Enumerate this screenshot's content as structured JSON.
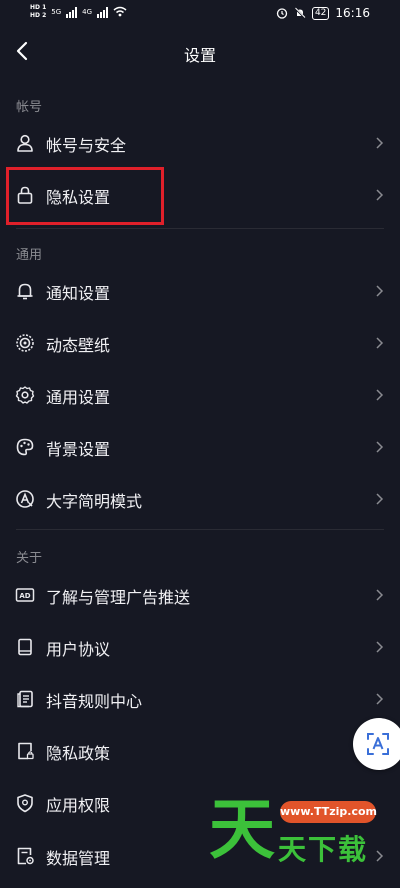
{
  "status_bar": {
    "hd1": "HD 1",
    "hd2": "HD 2",
    "net1": "5G",
    "net2": "4G",
    "battery": "42",
    "time": "16:16"
  },
  "header": {
    "title": "设置"
  },
  "sections": {
    "account": "帐号",
    "general": "通用",
    "about": "关于"
  },
  "items": {
    "account_security": "帐号与安全",
    "privacy_settings": "隐私设置",
    "notification_settings": "通知设置",
    "dynamic_wallpaper": "动态壁纸",
    "general_settings": "通用设置",
    "background_settings": "背景设置",
    "large_font_mode": "大字简明模式",
    "ad_management": "了解与管理广告推送",
    "user_agreement": "用户协议",
    "community_rules": "抖音规则中心",
    "privacy_policy": "隐私政策",
    "app_permissions": "应用权限",
    "data_management": "数据管理"
  },
  "watermark": {
    "site": "www.TTzip.com",
    "chars": "天下载"
  },
  "colors": {
    "background": "#161823",
    "highlight": "#e0202a",
    "watermark_green": "#3cc13a",
    "watermark_orange": "#e1542a"
  }
}
